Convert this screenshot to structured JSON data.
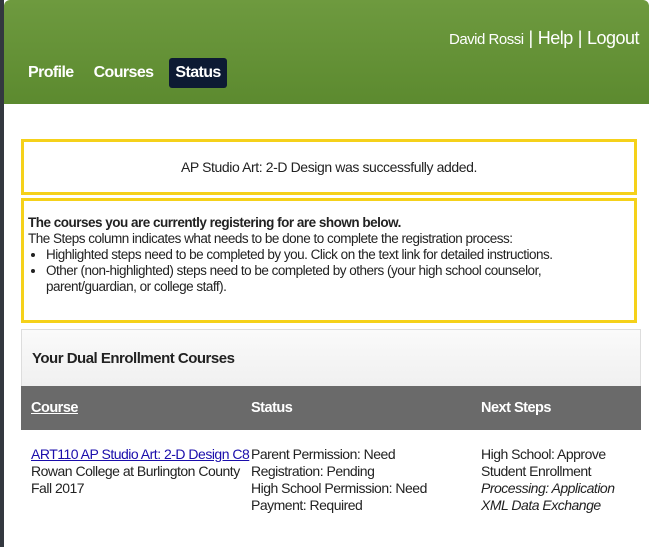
{
  "header": {
    "user_name": "David Rossi",
    "separator": "|",
    "help_link": "Help",
    "logout_link": "Logout",
    "nav": [
      {
        "label": "Profile",
        "active": false
      },
      {
        "label": "Courses",
        "active": false
      },
      {
        "label": "Status",
        "active": true
      }
    ],
    "colors": {
      "bar": "#6e9a3f",
      "active_tab": "#0d1a33",
      "panel_border": "#f5d11a"
    }
  },
  "success_message": "AP Studio Art: 2-D Design was successfully added.",
  "info": {
    "heading": "The courses you are currently registering for are shown below.",
    "subheading": "The Steps column indicates what needs to be done to complete the registration process:",
    "bullets": [
      "Highlighted steps need to be completed by you. Click on the text link for detailed instructions.",
      "Other (non-highlighted) steps need to be completed by others (your high school counselor, parent/guardian, or college staff)."
    ]
  },
  "courses": {
    "title": "Your Dual Enrollment Courses",
    "columns": [
      "Course",
      "Status",
      "Next Steps"
    ],
    "rows": [
      {
        "course_link": "ART110 AP Studio Art: 2-D Design C8",
        "college": "Rowan College at Burlington County",
        "term": "Fall 2017",
        "status": [
          "Parent Permission: Need",
          "Registration: Pending",
          "High School Permission: Need",
          "Payment: Required"
        ],
        "next_steps": [
          "High School: Approve Student Enrollment"
        ],
        "next_steps_italic": [
          "Processing: Application XML Data Exchange"
        ]
      }
    ]
  }
}
